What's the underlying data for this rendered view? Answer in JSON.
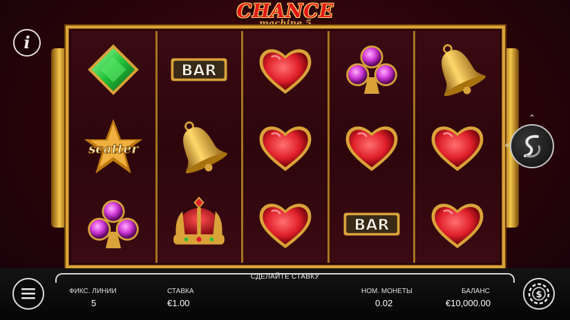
{
  "game": {
    "logo_main": "CHANCE",
    "logo_sub": "machine 5"
  },
  "reels": [
    [
      "diamond-gem",
      "scatter-star",
      "club-gem"
    ],
    [
      "bar",
      "bell",
      "crown"
    ],
    [
      "heart-gem",
      "heart-gem",
      "heart-gem"
    ],
    [
      "club-gem",
      "heart-gem",
      "bar"
    ],
    [
      "bell",
      "heart-gem",
      "heart-gem"
    ]
  ],
  "symbol_text": {
    "bar": "BAR",
    "scatter": "scatter"
  },
  "bottom": {
    "message": "СДЕЛАЙТЕ СТАВКУ",
    "lines_label": "ФИКС. ЛИНИИ",
    "lines_value": "5",
    "bet_label": "СТАВКА",
    "bet_value": "€1.00",
    "coin_label": "НОМ. МОНЕТЫ",
    "coin_value": "0.02",
    "balance_label": "БАЛАНС",
    "balance_value": "€10,000.00"
  },
  "icons": {
    "info": "info-icon",
    "menu": "menu-icon",
    "coin": "dollar-chip-icon",
    "spin": "spin-icon"
  },
  "colors": {
    "background": "#2a0409",
    "frame_gold": "#d9a33a",
    "heart_red": "#e0202a",
    "club_pink": "#d23ad8",
    "diamond_green": "#22c23a"
  }
}
